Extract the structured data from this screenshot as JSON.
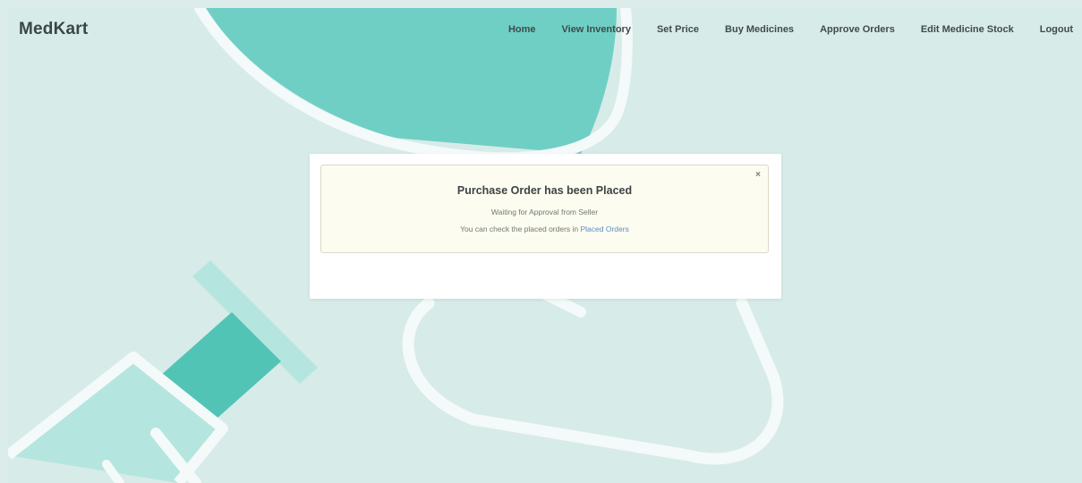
{
  "navbar": {
    "brand": "MedKart",
    "links": [
      "Home",
      "View Inventory",
      "Set Price",
      "Buy Medicines",
      "Approve Orders",
      "Edit Medicine Stock",
      "Logout"
    ]
  },
  "alert": {
    "title": "Purchase Order has been Placed",
    "line1": "Waiting for Approval from Seller",
    "line2_prefix": "You can check the placed orders in ",
    "line2_link": "Placed Orders",
    "close_symbol": "×"
  },
  "background": {
    "icons": [
      "stethoscope-icon",
      "capsule-icon",
      "syringe-icon"
    ]
  },
  "colors": {
    "background": "#d7ebe9",
    "accent_teal": "#6fcfc4",
    "accent_light": "#a8e0d8",
    "outline_white": "#f3faf9",
    "alert_bg": "#fcfcf0",
    "link": "#5b8ec4"
  }
}
